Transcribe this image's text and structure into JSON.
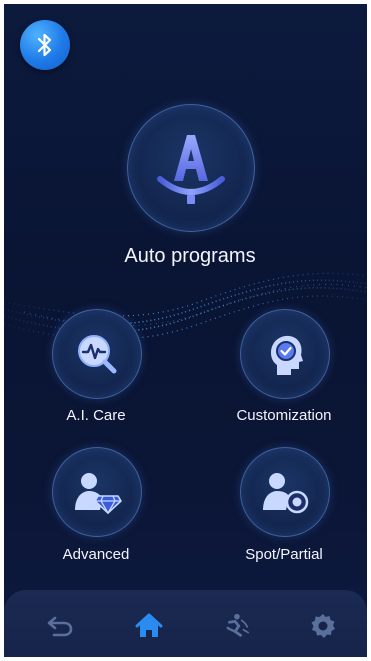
{
  "header": {
    "bluetooth_icon": "bluetooth-icon"
  },
  "main": {
    "label": "Auto programs",
    "icon": "auto-a-icon"
  },
  "menu": [
    {
      "label": "A.I. Care",
      "icon": "ai-care-icon"
    },
    {
      "label": "Customization",
      "icon": "customization-icon"
    },
    {
      "label": "Advanced",
      "icon": "advanced-icon"
    },
    {
      "label": "Spot/Partial",
      "icon": "spot-partial-icon"
    }
  ],
  "navbar": [
    {
      "icon": "back-icon",
      "active": false
    },
    {
      "icon": "home-icon",
      "active": true
    },
    {
      "icon": "massage-icon",
      "active": false
    },
    {
      "icon": "settings-icon",
      "active": false
    }
  ],
  "colors": {
    "background": "#0a1433",
    "accent": "#2a8cf0",
    "nav_inactive": "#5a6f99"
  }
}
